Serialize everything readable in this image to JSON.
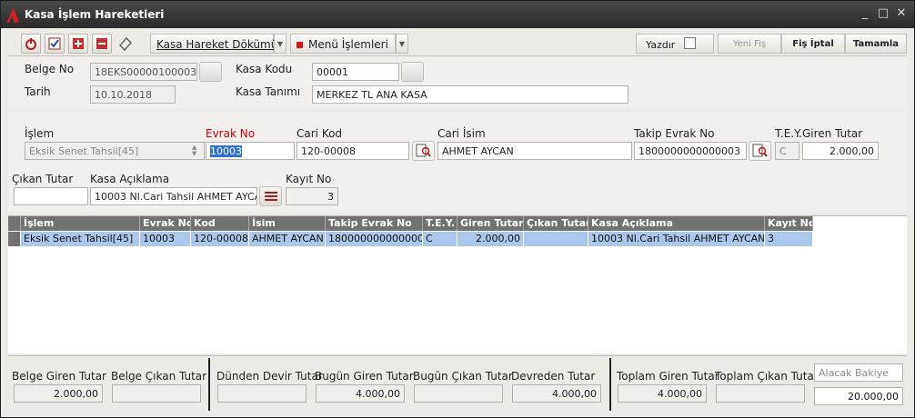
{
  "window": {
    "title": "Kasa İşlem Hareketleri",
    "min": "_",
    "max": "□",
    "close": "✕"
  },
  "toolbar": {
    "report_label": "Kasa Hareket Dökümü",
    "menu_label": "Menü İşlemleri",
    "print_label": "Yazdır",
    "new_label": "Yeni Fiş",
    "cancel_label": "Fiş İptal",
    "complete_label": "Tamamla"
  },
  "header": {
    "belge_no_label": "Belge No",
    "belge_no": "18EKS00000100003",
    "tarih_label": "Tarih",
    "tarih": "10.10.2018",
    "kasa_kodu_label": "Kasa Kodu",
    "kasa_kodu": "00001",
    "kasa_tanimi_label": "Kasa Tanımı",
    "kasa_tanimi": "MERKEZ TL ANA KASA"
  },
  "entry": {
    "islem_label": "İşlem",
    "islem": "Eksik Senet Tahsil[45]",
    "evrak_no_label": "Evrak No",
    "evrak_no": "10003",
    "cari_kod_label": "Cari Kod",
    "cari_kod": "120-00008",
    "cari_isim_label": "Cari İsim",
    "cari_isim": "AHMET AYCAN",
    "takip_label": "Takip Evrak No",
    "takip": "1800000000000003",
    "tey_label": "T.E.Y.",
    "tey": "C",
    "giren_label": "Giren Tutar",
    "giren": "2.000,00",
    "cikan_label": "Çıkan Tutar",
    "cikan": "",
    "aciklama_label": "Kasa Açıklama",
    "aciklama": "10003 Nl.Cari Tahsil AHMET AYCAN",
    "kayit_label": "Kayıt No",
    "kayit": "3"
  },
  "grid": {
    "headers": [
      "İşlem",
      "Evrak No",
      "Kod",
      "İsim",
      "Takip Evrak No",
      "T.E.Y.",
      "Giren Tutar",
      "Çıkan Tutar",
      "Kasa Açıklama",
      "Kayıt No"
    ],
    "rows": [
      [
        "Eksik Senet Tahsil[45]",
        "10003",
        "120-00008",
        "AHMET AYCAN",
        "1800000000000003",
        "C",
        "2.000,00",
        "",
        "10003 Nl.Cari Tahsil AHMET AYCAN",
        "3"
      ]
    ]
  },
  "footer": {
    "belge_giren_label": "Belge Giren Tutar",
    "belge_giren": "2.000,00",
    "belge_cikan_label": "Belge Çıkan Tutar",
    "belge_cikan": "",
    "dunden_label": "Dünden Devir Tutar",
    "dunden": "",
    "bugun_giren_label": "Bugün Giren Tutar",
    "bugun_giren": "4.000,00",
    "bugun_cikan_label": "Bugün Çıkan Tutar",
    "bugun_cikan": "",
    "devreden_label": "Devreden Tutar",
    "devreden": "4.000,00",
    "toplam_giren_label": "Toplam Giren Tutar",
    "toplam_giren": "4.000,00",
    "toplam_cikan_label": "Toplam Çıkan Tutar",
    "toplam_cikan": "",
    "alacak_label": "Alacak Bakiye",
    "alacak": "20.000,00"
  },
  "colors": {
    "titlebar": "#2f2f2f",
    "grid_header": "#727272",
    "selected_row": "#a9c8ec",
    "required_label": "#cc0000"
  }
}
